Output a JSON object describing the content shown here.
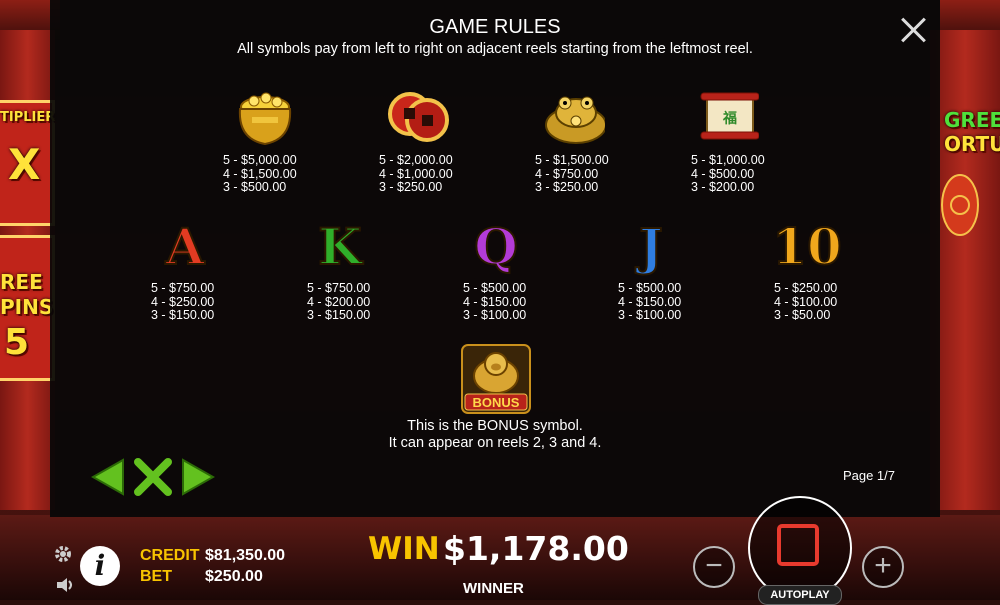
{
  "rules": {
    "title": "GAME RULES",
    "subtitle": "All symbols pay from left to right on adjacent reels starting from the leftmost reel.",
    "symbols_row1": [
      {
        "name": "gold-pot",
        "pays": [
          "5 - $5,000.00",
          "4 - $1,500.00",
          "3 - $500.00"
        ]
      },
      {
        "name": "coin-knot",
        "pays": [
          "5 - $2,000.00",
          "4 - $1,000.00",
          "3 - $250.00"
        ]
      },
      {
        "name": "golden-frog",
        "pays": [
          "5 - $1,500.00",
          "4 - $750.00",
          "3 - $250.00"
        ]
      },
      {
        "name": "scroll",
        "pays": [
          "5 - $1,000.00",
          "4 - $500.00",
          "3 - $200.00"
        ]
      }
    ],
    "symbols_row2": [
      {
        "letter": "A",
        "color": "#e23b22",
        "pays": [
          "5 - $750.00",
          "4 - $250.00",
          "3 - $150.00"
        ]
      },
      {
        "letter": "K",
        "color": "#2fae2a",
        "pays": [
          "5 - $750.00",
          "4 - $200.00",
          "3 - $150.00"
        ]
      },
      {
        "letter": "Q",
        "color": "#b33bd6",
        "pays": [
          "5 - $500.00",
          "4 - $150.00",
          "3 - $100.00"
        ]
      },
      {
        "letter": "J",
        "color": "#2f7de0",
        "pays": [
          "5 - $500.00",
          "4 - $150.00",
          "3 - $100.00"
        ]
      },
      {
        "letter": "10",
        "color": "#f0a71c",
        "pays": [
          "5 - $250.00",
          "4 - $100.00",
          "3 - $50.00"
        ]
      }
    ],
    "bonus": {
      "badge": "BONUS",
      "line1": "This is the BONUS symbol.",
      "line2": "It can appear on reels 2, 3 and 4."
    },
    "page": "Page 1/7"
  },
  "side": {
    "left_multiplier_label": "TIPLIER",
    "left_multiplier_value": "X",
    "left_free": "REE",
    "left_spins": "PINS",
    "left_spins_count": "5",
    "right_title1": "GREEN",
    "right_title2": "ORTUNE"
  },
  "hud": {
    "credit_label": "CREDIT",
    "credit_value": "$81,350.00",
    "bet_label": "BET",
    "bet_value": "$250.00",
    "win_label": "WIN",
    "win_value": "$1,178.00",
    "winner": "WINNER",
    "autoplay": "AUTOPLAY",
    "info": "i",
    "minus": "−",
    "plus": "+"
  },
  "colors": {
    "accent_gold": "#f8c400",
    "nav_green": "#63c11f",
    "spin_red": "#e83a2e"
  }
}
